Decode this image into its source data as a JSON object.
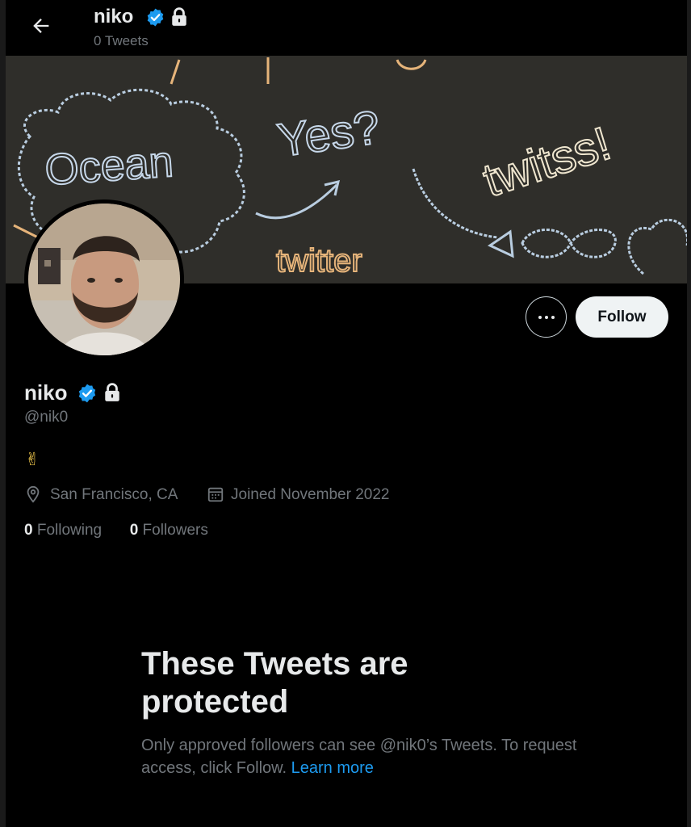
{
  "header": {
    "name": "niko",
    "subtitle": "0 Tweets"
  },
  "icons": {
    "back": "arrow-left-icon",
    "verified": "verified-badge-icon",
    "lock": "lock-icon",
    "more": "more-dots-icon",
    "location": "location-pin-icon",
    "calendar": "calendar-icon"
  },
  "banner": {
    "words": [
      "Ocean",
      "Yes?",
      "twitss!",
      "twitter"
    ]
  },
  "actions": {
    "follow_label": "Follow"
  },
  "profile": {
    "name": "niko",
    "handle": "@nik0",
    "bio": "✌",
    "location": "San Francisco, CA",
    "joined": "Joined November 2022",
    "following_count": "0",
    "following_label": " Following",
    "followers_count": "0",
    "followers_label": " Followers"
  },
  "protected": {
    "title": "These Tweets are protected",
    "body": "Only approved followers can see @nik0’s Tweets. To request access, click Follow. ",
    "link": "Learn more"
  },
  "colors": {
    "background": "#000000",
    "primary_text": "#e7e9ea",
    "secondary_text": "#71767b",
    "link": "#1d9bf0",
    "verified": "#1d9bf0",
    "follow_button_bg": "#eff3f4"
  }
}
